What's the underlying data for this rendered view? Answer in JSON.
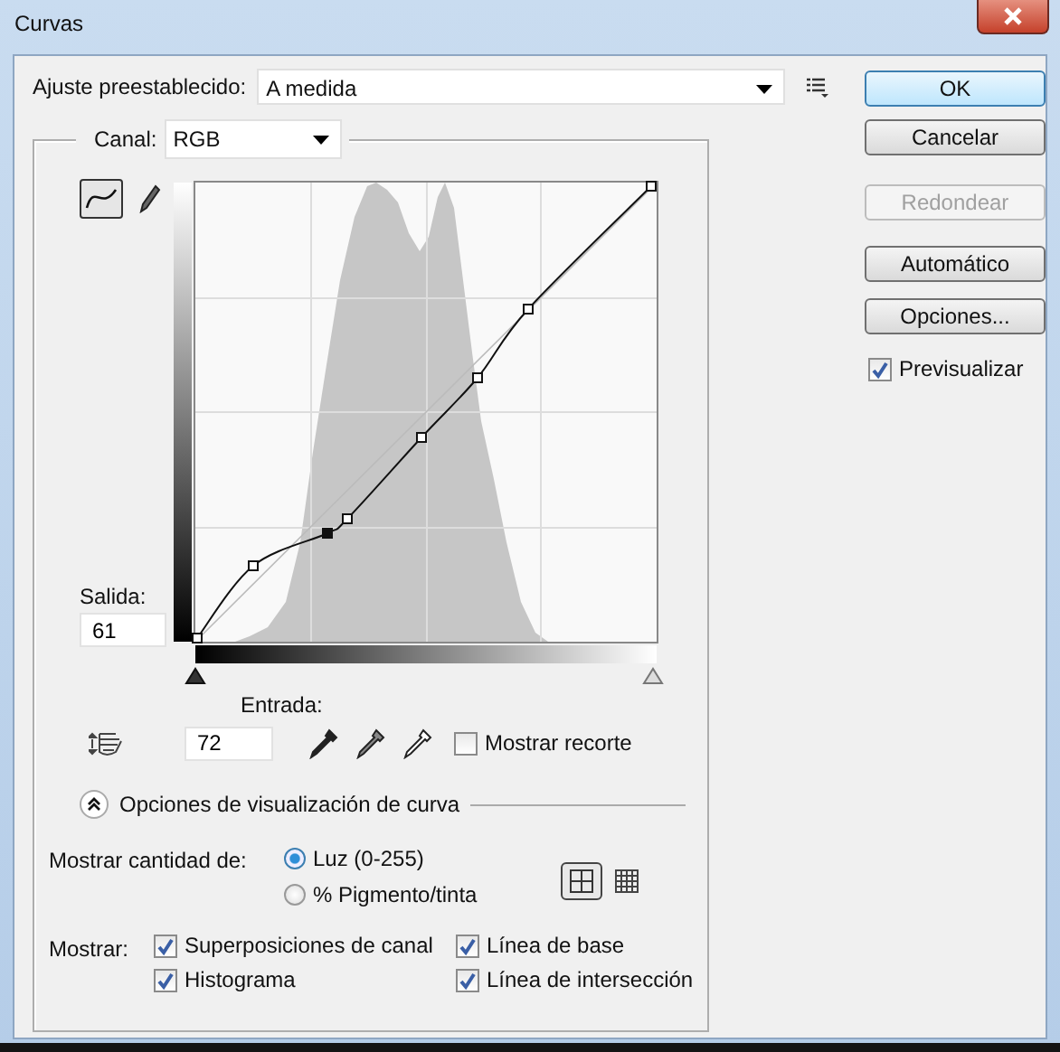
{
  "window": {
    "title": "Curvas"
  },
  "preset": {
    "label": "Ajuste preestablecido:",
    "value": "A medida"
  },
  "channel": {
    "label": "Canal:",
    "value": "RGB"
  },
  "tools": [
    {
      "kind": "curve",
      "selected": true
    },
    {
      "kind": "pencil",
      "selected": false
    }
  ],
  "output": {
    "label": "Salida:",
    "value": "61"
  },
  "input": {
    "label": "Entrada:",
    "value": "72"
  },
  "show_clipping": {
    "label": "Mostrar recorte",
    "checked": false
  },
  "display_options": {
    "title": "Opciones de visualización de curva",
    "expanded": true
  },
  "show_amount": {
    "label": "Mostrar cantidad de:",
    "options": [
      {
        "label": "Luz (0-255)",
        "selected": true
      },
      {
        "label": "% Pigmento/tinta",
        "selected": false
      }
    ]
  },
  "grid": [
    {
      "kind": "simple",
      "selected": true
    },
    {
      "kind": "detailed",
      "selected": false
    }
  ],
  "show": {
    "label": "Mostrar:",
    "options": [
      {
        "label": "Superposiciones de canal",
        "checked": true
      },
      {
        "label": "Línea de base",
        "checked": true
      },
      {
        "label": "Histograma",
        "checked": true
      },
      {
        "label": "Línea de intersección",
        "checked": true
      }
    ]
  },
  "buttons": [
    {
      "label": "OK",
      "default": true,
      "disabled": false
    },
    {
      "label": "Cancelar",
      "default": false,
      "disabled": false
    },
    {
      "label": "Redondear",
      "default": false,
      "disabled": true
    },
    {
      "label": "Automático",
      "default": false,
      "disabled": false
    },
    {
      "label": "Opciones...",
      "default": false,
      "disabled": false
    }
  ],
  "preview": {
    "label": "Previsualizar",
    "checked": true
  }
}
